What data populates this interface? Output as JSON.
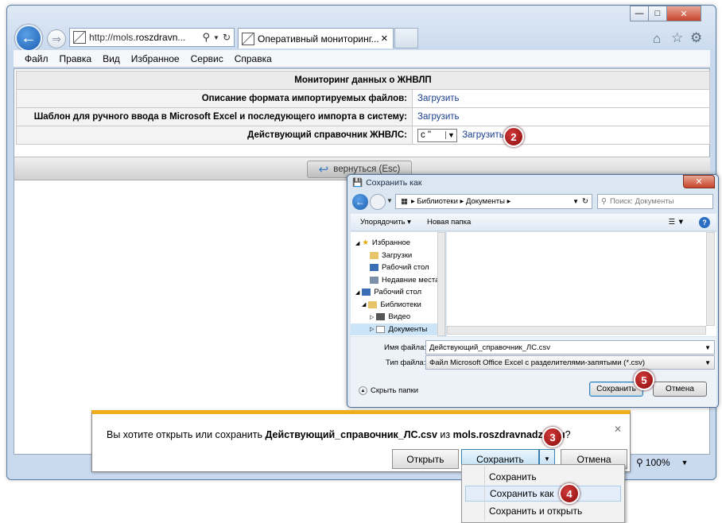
{
  "browser": {
    "address": "http://mols.roszdravn...",
    "address_host": "roszdravn",
    "address_prefix": "http://mols.",
    "tab_title": "Оперативный мониторинг...",
    "zoom": "100%"
  },
  "menu": [
    "Файл",
    "Правка",
    "Вид",
    "Избранное",
    "Сервис",
    "Справка"
  ],
  "page": {
    "header": "Мониторинг данных о ЖНВЛП",
    "rows": [
      {
        "label": "Описание формата импортируемых файлов:",
        "link": "Загрузить"
      },
      {
        "label": "Шаблон для ручного ввода в Microsoft Excel и последующего импорта в систему:",
        "link": "Загрузить"
      },
      {
        "label": "Действующий справочник ЖНВЛС:",
        "select": "с \"",
        "link": "Загрузить"
      }
    ],
    "return_button": "вернуться (Esc)"
  },
  "saveas": {
    "title": "Сохранить как",
    "path": [
      "Библиотеки",
      "Документы"
    ],
    "search_placeholder": "Поиск: Документы",
    "toolbar": {
      "organize": "Упорядочить ▾",
      "new_folder": "Новая папка"
    },
    "tree": [
      {
        "label": "Избранное",
        "level": 0
      },
      {
        "label": "Загрузки",
        "level": 1
      },
      {
        "label": "Рабочий стол",
        "level": 1
      },
      {
        "label": "Недавние места",
        "level": 1
      },
      {
        "label": "Рабочий стол",
        "level": 0
      },
      {
        "label": "Библиотеки",
        "level": 1
      },
      {
        "label": "Видео",
        "level": 2
      },
      {
        "label": "Документы",
        "level": 2
      }
    ],
    "filename_label": "Имя файла:",
    "filename": "Действующий_справочник_ЛС.csv",
    "filetype_label": "Тип файла:",
    "filetype": "Файл Microsoft Office Excel с разделителями-запятыми (*.csv)",
    "hide_folders": "Скрыть папки",
    "save": "Сохранить",
    "cancel": "Отмена"
  },
  "download": {
    "prefix": "Вы хотите открыть или сохранить ",
    "filename": "Действующий_справочник_ЛС.csv",
    "middle": " из ",
    "host": "mols.roszdravnadzor.ru",
    "suffix": "?",
    "open": "Открыть",
    "save": "Сохранить",
    "cancel": "Отмена",
    "menu": [
      "Сохранить",
      "Сохранить как",
      "Сохранить и открыть"
    ]
  },
  "badges": [
    "2",
    "3",
    "4",
    "5"
  ],
  "colors": {
    "badge": "#a01414",
    "notification_bar": "#f0ad1b",
    "link": "#1a3d8c"
  }
}
